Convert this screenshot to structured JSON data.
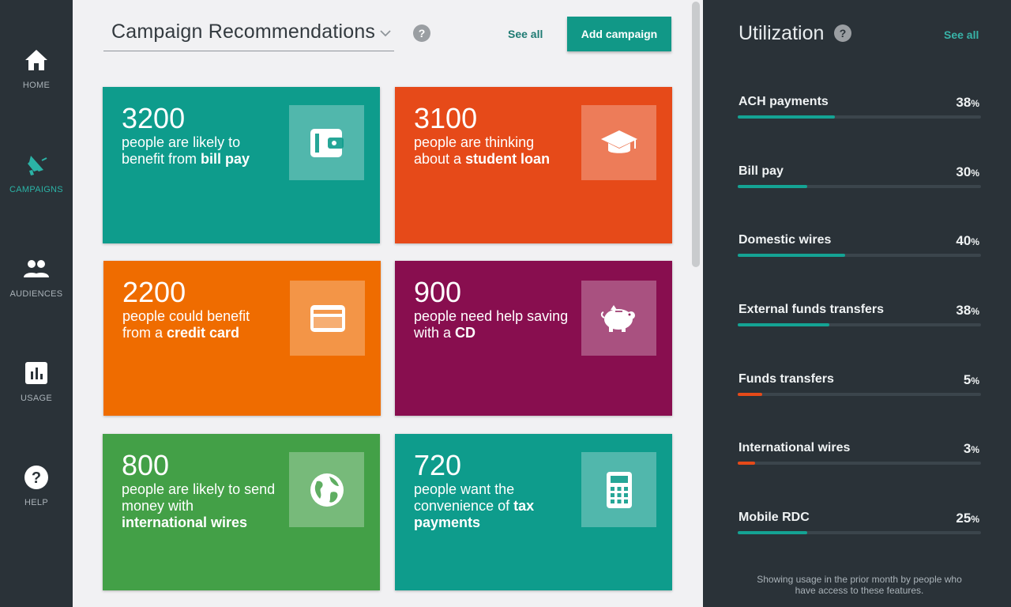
{
  "nav": {
    "items": [
      {
        "label": "HOME",
        "icon": "home-icon"
      },
      {
        "label": "CAMPAIGNS",
        "icon": "megaphone-icon",
        "active": true
      },
      {
        "label": "AUDIENCES",
        "icon": "people-icon"
      },
      {
        "label": "USAGE",
        "icon": "bar-chart-icon"
      },
      {
        "label": "HELP",
        "icon": "help-icon"
      }
    ],
    "colors": {
      "background": "#2a3238",
      "active": "#2bb3a6",
      "inactive": "#aab3b9"
    }
  },
  "header": {
    "select_value": "Campaign Recommendations",
    "help": "?",
    "see_all": "See all",
    "add_campaign": "Add campaign"
  },
  "cards": [
    {
      "count": "3200",
      "text_plain": "people are likely to benefit from ",
      "text_bold": "bill pay",
      "icon": "wallet-icon",
      "color": "#0e9c8c"
    },
    {
      "count": "3100",
      "text_plain": "people are thinking about a ",
      "text_bold": "student loan",
      "icon": "graduation-cap-icon",
      "color": "#e64a19"
    },
    {
      "count": "2200",
      "text_plain": "people could benefit from a ",
      "text_bold": "credit card",
      "icon": "credit-card-icon",
      "color": "#ef6c00"
    },
    {
      "count": "900",
      "text_plain": "people need help saving with a ",
      "text_bold": "CD",
      "icon": "piggy-bank-icon",
      "color": "#880e4f"
    },
    {
      "count": "800",
      "text_plain": "people are likely to send money with ",
      "text_bold": "international wires",
      "icon": "globe-icon",
      "color": "#43a047"
    },
    {
      "count": "720",
      "text_plain": "people want the convenience of ",
      "text_bold": "tax payments",
      "icon": "calculator-icon",
      "color": "#0e9c8c"
    }
  ],
  "utilization": {
    "title": "Utilization",
    "help": "?",
    "see_all": "See all",
    "items": [
      {
        "name": "ACH payments",
        "value": "38",
        "fill_percent": 40,
        "color": "#14a394"
      },
      {
        "name": "Bill pay",
        "value": "30",
        "fill_percent": 28.5,
        "color": "#14a394"
      },
      {
        "name": "Domestic wires",
        "value": "40",
        "fill_percent": 44,
        "color": "#14a394"
      },
      {
        "name": "External funds transfers",
        "value": "38",
        "fill_percent": 37.5,
        "color": "#14a394"
      },
      {
        "name": "Funds transfers",
        "value": "5",
        "fill_percent": 10,
        "color": "#e64a19"
      },
      {
        "name": "International wires",
        "value": "3",
        "fill_percent": 7,
        "color": "#e64a19"
      },
      {
        "name": "Mobile RDC",
        "value": "25",
        "fill_percent": 28.5,
        "color": "#14a394"
      }
    ],
    "unit": "%",
    "footnote": "Showing usage in the prior month by people who have access to these features."
  }
}
